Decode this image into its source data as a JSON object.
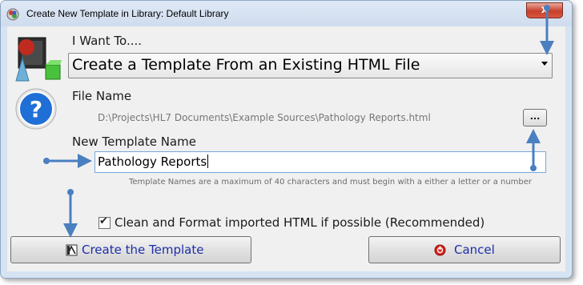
{
  "window": {
    "title": "Create New Template in Library: Default Library",
    "close_glyph": "x"
  },
  "sections": {
    "action_label": "I Want To....",
    "action_value": "Create a Template From an Existing HTML File",
    "file_label": "File Name",
    "file_path": "D:\\Projects\\HL7 Documents\\Example Sources\\Pathology Reports.html",
    "browse_label": "...",
    "name_label": "New Template Name",
    "name_value": "Pathology Reports",
    "name_hint": "Template Names are a maximum of 40 characters and must begin with a either a letter or a number",
    "clean_label": "Clean and Format imported HTML if possible (Recommended)",
    "clean_checked": true
  },
  "buttons": {
    "create": "Create the Template",
    "cancel": "Cancel"
  },
  "icons": [
    "app-icon",
    "template-wizard-icon",
    "help-icon",
    "create-icon",
    "cancel-icon",
    "checkmark-icon"
  ],
  "colors": {
    "accent": "#1c2fa8",
    "annotation_arrow": "#4a7fc0",
    "close": "#c7402b"
  }
}
